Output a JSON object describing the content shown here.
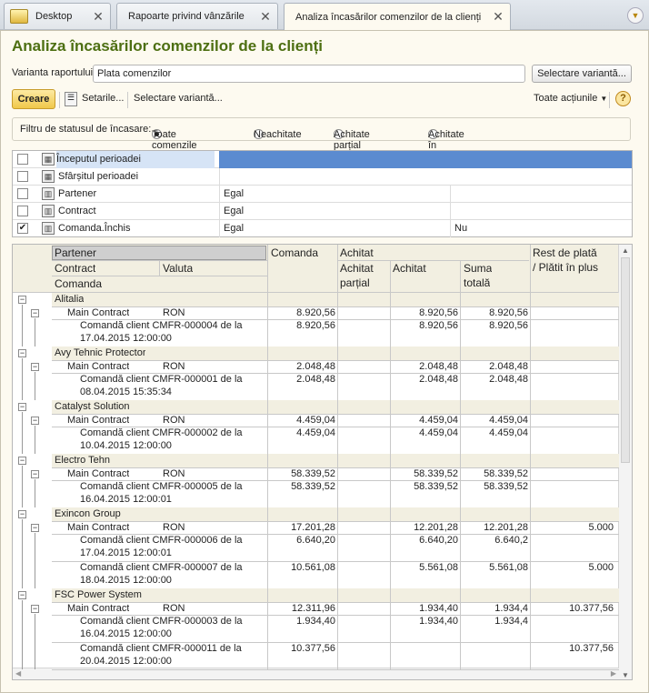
{
  "tabs": [
    {
      "label": "Desktop"
    },
    {
      "label": "Rapoarte privind vânzările"
    },
    {
      "label": "Analiza încasărilor comenzilor de la clienți"
    }
  ],
  "title": "Analiza încasărilor comenzilor de la clienți",
  "variant": {
    "label": "Varianta raportului:",
    "value": "Plata comenzilor",
    "select_button": "Selectare variantă..."
  },
  "toolbar": {
    "create": "Creare",
    "settings": "Setarile...",
    "select_variant": "Selectare variantă...",
    "all_actions": "Toate acțiunile",
    "help": "?"
  },
  "filter": {
    "label": "Filtru de statusul de încasare:",
    "options": [
      {
        "label": "Toate comenzile",
        "selected": true
      },
      {
        "label": "Neachitate",
        "selected": false
      },
      {
        "label": "Achitate parțial",
        "selected": false
      },
      {
        "label": "Achitate în totalitate",
        "selected": false
      }
    ]
  },
  "settings_rows": [
    {
      "name": "Începutul perioadei",
      "checked": false,
      "condition": "",
      "value": ""
    },
    {
      "name": "Sfârșitul perioadei",
      "checked": false,
      "condition": "",
      "value": ""
    },
    {
      "name": "Partener",
      "checked": false,
      "condition": "Egal",
      "value": ""
    },
    {
      "name": "Contract",
      "checked": false,
      "condition": "Egal",
      "value": ""
    },
    {
      "name": "Comanda.Închis",
      "checked": true,
      "condition": "Egal",
      "value": "Nu"
    }
  ],
  "report": {
    "headers": {
      "partener": "Partener",
      "contract": "Contract",
      "valuta": "Valuta",
      "comanda_row": "Comanda",
      "comanda": "Comanda",
      "achitat": "Achitat",
      "achitat_partial_1": "Achitat",
      "achitat_partial_2": "parțial",
      "achitat_sub": "Achitat",
      "suma_1": "Suma",
      "suma_2": "totală",
      "rest_1": "Rest de plată",
      "rest_2": "/ Plătit în plus"
    },
    "groups": [
      {
        "partner": "Alitalia",
        "contract": "Main Contract",
        "currency": "RON",
        "totals": {
          "comanda": "8.920,56",
          "partial": "",
          "achitat": "8.920,56",
          "suma": "8.920,56",
          "rest": ""
        },
        "orders": [
          {
            "line1": "Comandă client CMFR-000004 de la",
            "line2": "17.04.2015 12:00:00",
            "comanda": "8.920,56",
            "partial": "",
            "achitat": "8.920,56",
            "suma": "8.920,56",
            "rest": ""
          }
        ]
      },
      {
        "partner": "Avy Tehnic Protector",
        "contract": "Main Contract",
        "currency": "RON",
        "totals": {
          "comanda": "2.048,48",
          "partial": "",
          "achitat": "2.048,48",
          "suma": "2.048,48",
          "rest": ""
        },
        "orders": [
          {
            "line1": "Comandă client CMFR-000001 de la",
            "line2": "08.04.2015 15:35:34",
            "comanda": "2.048,48",
            "partial": "",
            "achitat": "2.048,48",
            "suma": "2.048,48",
            "rest": ""
          }
        ]
      },
      {
        "partner": "Catalyst Solution",
        "contract": "Main Contract",
        "currency": "RON",
        "totals": {
          "comanda": "4.459,04",
          "partial": "",
          "achitat": "4.459,04",
          "suma": "4.459,04",
          "rest": ""
        },
        "orders": [
          {
            "line1": "Comandă client CMFR-000002 de la",
            "line2": "10.04.2015 12:00:00",
            "comanda": "4.459,04",
            "partial": "",
            "achitat": "4.459,04",
            "suma": "4.459,04",
            "rest": ""
          }
        ]
      },
      {
        "partner": "Electro Tehn",
        "contract": "Main Contract",
        "currency": "RON",
        "totals": {
          "comanda": "58.339,52",
          "partial": "",
          "achitat": "58.339,52",
          "suma": "58.339,52",
          "rest": ""
        },
        "orders": [
          {
            "line1": "Comandă client CMFR-000005 de la",
            "line2": "16.04.2015 12:00:01",
            "comanda": "58.339,52",
            "partial": "",
            "achitat": "58.339,52",
            "suma": "58.339,52",
            "rest": ""
          }
        ]
      },
      {
        "partner": "Exincon Group",
        "contract": "Main Contract",
        "currency": "RON",
        "totals": {
          "comanda": "17.201,28",
          "partial": "",
          "achitat": "12.201,28",
          "suma": "12.201,28",
          "rest": "5.000"
        },
        "orders": [
          {
            "line1": "Comandă client CMFR-000006 de la",
            "line2": "17.04.2015 12:00:01",
            "comanda": "6.640,20",
            "partial": "",
            "achitat": "6.640,20",
            "suma": "6.640,2",
            "rest": ""
          },
          {
            "line1": "Comandă client CMFR-000007 de la",
            "line2": "18.04.2015 12:00:00",
            "comanda": "10.561,08",
            "partial": "",
            "achitat": "5.561,08",
            "suma": "5.561,08",
            "rest": "5.000"
          }
        ]
      },
      {
        "partner": "FSC Power System",
        "contract": "Main Contract",
        "currency": "RON",
        "totals": {
          "comanda": "12.311,96",
          "partial": "",
          "achitat": "1.934,40",
          "suma": "1.934,4",
          "rest": "10.377,56"
        },
        "orders": [
          {
            "line1": "Comandă client CMFR-000003 de la",
            "line2": "16.04.2015 12:00:00",
            "comanda": "1.934,40",
            "partial": "",
            "achitat": "1.934,40",
            "suma": "1.934,4",
            "rest": ""
          },
          {
            "line1": "Comandă client CMFR-000011 de la",
            "line2": "20.04.2015 12:00:00",
            "comanda": "10.377,56",
            "partial": "",
            "achitat": "",
            "suma": "",
            "rest": "10.377,56"
          }
        ]
      }
    ]
  },
  "colors": {
    "title": "#4d6f12",
    "accent": "#f5d46c",
    "selected_row": "#5b8bd0"
  }
}
